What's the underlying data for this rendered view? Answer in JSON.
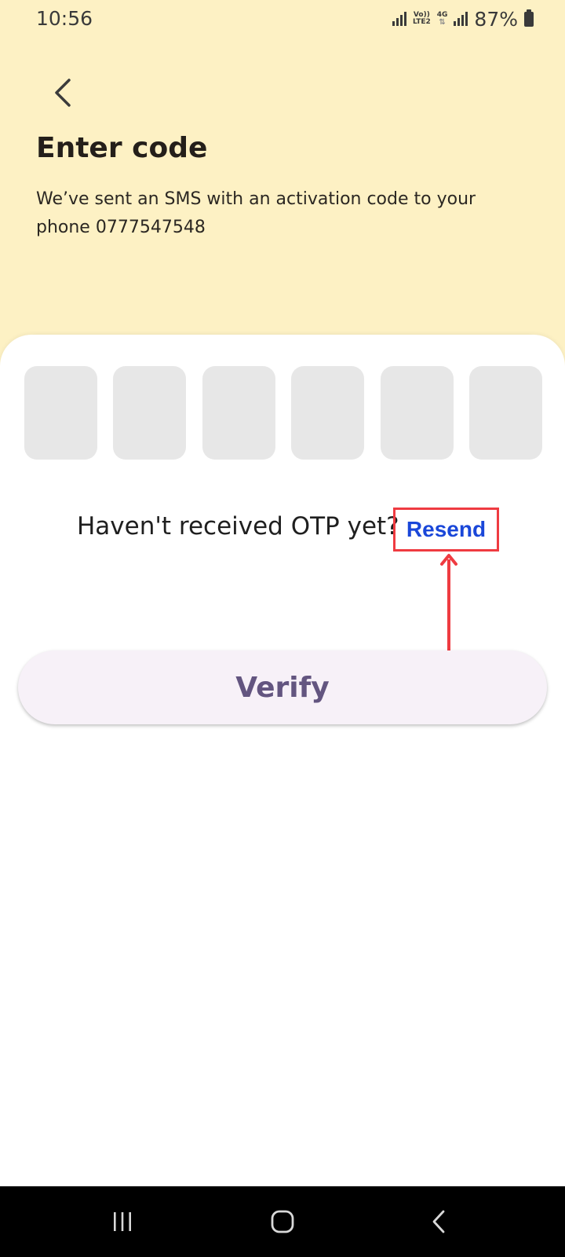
{
  "status_bar": {
    "time": "10:56",
    "network_volte": "Vo))",
    "network_lte": "LTE2",
    "network_4g": "4G",
    "battery_percent": "87%"
  },
  "header": {
    "back_icon": "chevron-left-icon",
    "title": "Enter code",
    "subtitle": "We’ve sent an SMS with an activation code to your phone 0777547548"
  },
  "otp": {
    "digits": [
      "",
      "",
      "",
      "",
      "",
      ""
    ]
  },
  "resend": {
    "prompt": "Haven't received OTP yet?",
    "link_label": "Resend"
  },
  "verify": {
    "label": "Verify"
  },
  "nav_bar": {
    "icons": [
      "recent-apps-icon",
      "home-icon",
      "back-icon"
    ]
  },
  "colors": {
    "header_background": "#fdf1c4",
    "otp_box": "#e7e7e7",
    "resend_link": "#1a47d9",
    "annotation": "#ef3b41",
    "verify_background": "#f7f1f8",
    "verify_text": "#635580"
  }
}
